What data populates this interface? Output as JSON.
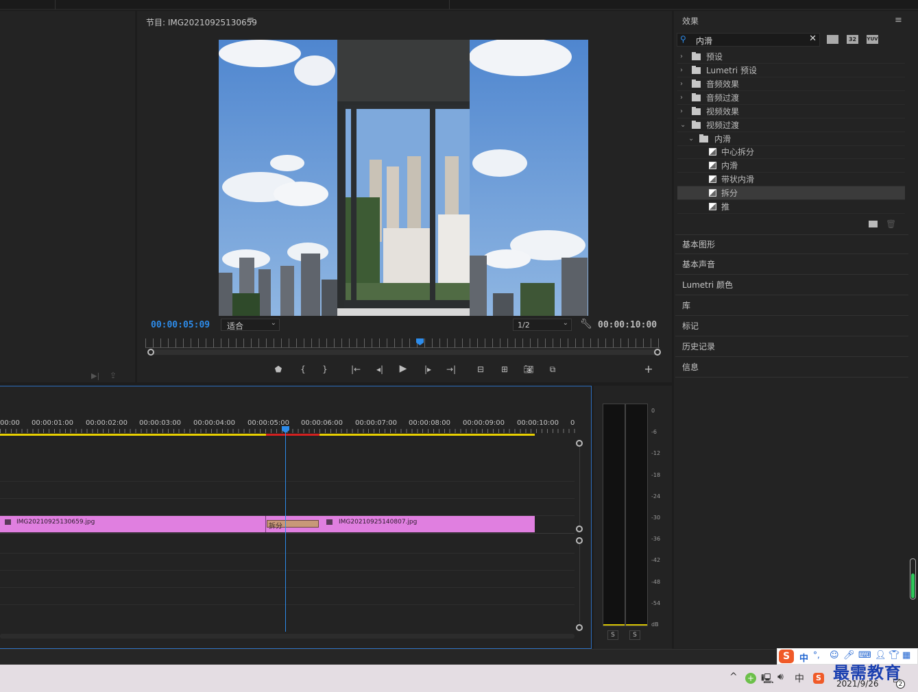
{
  "program_monitor": {
    "title": "节目: IMG20210925130659",
    "menu_glyph": "≡",
    "current_time": "00:00:05:09",
    "fit_label": "适合",
    "resolution_label": "1/2",
    "duration": "00:00:10:00",
    "playhead_fraction": 0.53
  },
  "effects_panel": {
    "title": "效果",
    "menu_glyph": "≡",
    "search_value": "内滑",
    "filter_icons": [
      "accelerated-effects-icon",
      "32bit-icon",
      "yuv-icon"
    ],
    "filter_labels": [
      "",
      "32",
      "YUV"
    ],
    "tree": [
      {
        "label": "预设",
        "expanded": false,
        "depth": 0,
        "type": "preset-folder"
      },
      {
        "label": "Lumetri 预设",
        "expanded": false,
        "depth": 0,
        "type": "preset-folder"
      },
      {
        "label": "音频效果",
        "expanded": false,
        "depth": 0,
        "type": "folder"
      },
      {
        "label": "音频过渡",
        "expanded": false,
        "depth": 0,
        "type": "folder"
      },
      {
        "label": "视频效果",
        "expanded": false,
        "depth": 0,
        "type": "folder"
      },
      {
        "label": "视频过渡",
        "expanded": true,
        "depth": 0,
        "type": "folder"
      },
      {
        "label": "内滑",
        "expanded": true,
        "depth": 1,
        "type": "folder"
      },
      {
        "label": "中心拆分",
        "depth": 2,
        "type": "effect"
      },
      {
        "label": "内滑",
        "depth": 2,
        "type": "effect"
      },
      {
        "label": "带状内滑",
        "depth": 2,
        "type": "effect"
      },
      {
        "label": "拆分",
        "depth": 2,
        "type": "effect",
        "selected": true
      },
      {
        "label": "推",
        "depth": 2,
        "type": "effect"
      }
    ]
  },
  "side_sections": [
    "基本图形",
    "基本声音",
    "Lumetri 颜色",
    "库",
    "标记",
    "历史记录",
    "信息"
  ],
  "timeline": {
    "ruler_labels": [
      "00:00",
      "00:00:01:00",
      "00:00:02:00",
      "00:00:03:00",
      "00:00:04:00",
      "00:00:05:00",
      "00:00:06:00",
      "00:00:07:00",
      "00:00:08:00",
      "00:00:09:00",
      "00:00:10:00",
      "0"
    ],
    "clips": [
      {
        "name": "IMG20210925130659.jpg"
      },
      {
        "name": "IMG20210925140807.jpg"
      }
    ],
    "transition_label": "拆分"
  },
  "audio_meter": {
    "scale": [
      "0",
      "-6",
      "-12",
      "-18",
      "-24",
      "-30",
      "-36",
      "-42",
      "-48",
      "-54",
      "dB"
    ],
    "solo_labels": [
      "S",
      "S"
    ]
  },
  "taskbar": {
    "ime_label": "中",
    "lang_label": "中",
    "date": "2021/9/26",
    "watermark": "最需教育",
    "notification_count": "2"
  },
  "colors": {
    "accent_blue": "#2d8ceb",
    "clip_pink": "#e07fe0",
    "transition_tan": "#c89878",
    "render_yellow": "#e8d000",
    "render_red": "#d42020"
  }
}
